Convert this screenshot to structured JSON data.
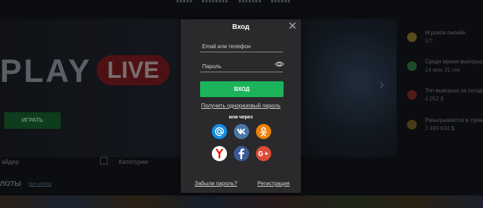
{
  "background": {
    "logo": {
      "play": "PLAY",
      "live": "LIVE"
    },
    "play_button": "ИГРАТЬ",
    "sidebar": [
      {
        "title": "Игроков онлайн",
        "value": "57!"
      },
      {
        "title": "Средн время выигрыша",
        "value": "14 мин 31 сек"
      },
      {
        "title": "Топ выигрыш за сегодня",
        "value": "4 052 $"
      },
      {
        "title": "Разыгрывается в турнирах",
        "value": "2 489 634 $"
      }
    ],
    "filters": {
      "provider": "айдер",
      "categories": "Категории"
    },
    "section_title": "ЛОТЫ",
    "section_link": "все слоты"
  },
  "modal": {
    "title": "Вход",
    "email_placeholder": "Email или телефон",
    "password_placeholder": "Пароль",
    "login_button": "ВХОД",
    "otp_link": "Получить одноразовый пароль",
    "or_via": "или через",
    "socials": [
      {
        "name": "mail-ru",
        "color": "#168de2"
      },
      {
        "name": "vk",
        "color": "#4a76a8"
      },
      {
        "name": "odnoklassniki",
        "color": "#ee8208"
      },
      {
        "name": "yandex",
        "color": "#ffffff"
      },
      {
        "name": "facebook",
        "color": "#3b5998"
      },
      {
        "name": "google-plus",
        "color": "#dd4b39"
      }
    ],
    "forgot_password": "Забыли пароль?",
    "register": "Регистрация"
  },
  "colors": {
    "accent": "#1bb45a",
    "modal_bg": "#2a2a2c"
  }
}
